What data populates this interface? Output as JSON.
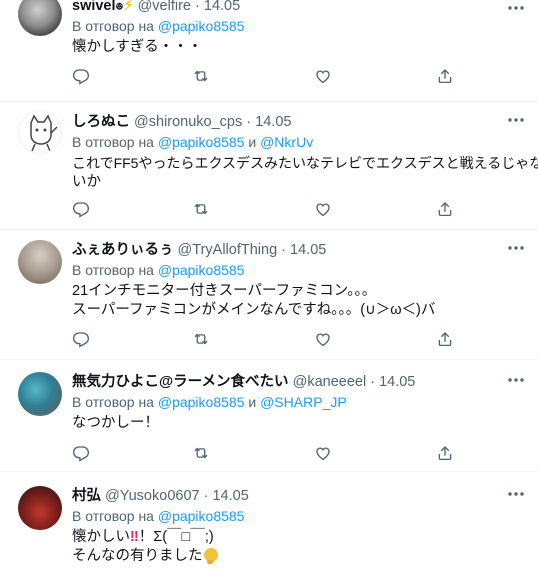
{
  "reply_prefix": "В отговор на",
  "reply_and": "и",
  "tweets": [
    {
      "name": "swivel",
      "name_emoji": "⚡",
      "handle": "@velfire",
      "dot": "·",
      "date": "14.05",
      "mentions": [
        "@papiko8585"
      ],
      "lines": [
        "懐かしすぎる・・・"
      ]
    },
    {
      "name": "しろぬこ",
      "handle": "@shironuko_cps",
      "dot": "·",
      "date": "14.05",
      "mentions": [
        "@papiko8585",
        "@NkrUv"
      ],
      "lines": [
        "これでFF5やったらエクスデスみたいなテレビでエクスデスと戦えるじゃな",
        "いか"
      ]
    },
    {
      "name": "ふぇありぃるぅ",
      "handle": "@TryAllofThing",
      "dot": "·",
      "date": "14.05",
      "mentions": [
        "@papiko8585"
      ],
      "lines": [
        "21インチモニター付きスーパーファミコン。。。",
        "スーパーファミコンがメインなんですね。。。(∪＞ω＜)バ"
      ]
    },
    {
      "name": "無気力ひよこ@ラーメン食べたい",
      "handle": "@kaneeeel",
      "dot": "·",
      "date": "14.05",
      "mentions": [
        "@papiko8585",
        "@SHARP_JP"
      ],
      "lines": [
        "なつかしー！"
      ]
    },
    {
      "name": "村弘",
      "handle": "@Yusoko0607",
      "dot": "·",
      "date": "14.05",
      "mentions": [
        "@papiko8585"
      ],
      "line1_a": "懐かしい",
      "line1_bang": "‼",
      "line1_b": "！Σ(￣□￣;)",
      "line2": "そんなの有りました"
    }
  ],
  "icons": [
    "more-icon",
    "reply-icon",
    "retweet-icon",
    "like-icon",
    "share-icon"
  ],
  "colors": {
    "link": "#1d9bf0",
    "meta": "#536471",
    "divider": "#eff3f4",
    "icon": "#536471"
  }
}
